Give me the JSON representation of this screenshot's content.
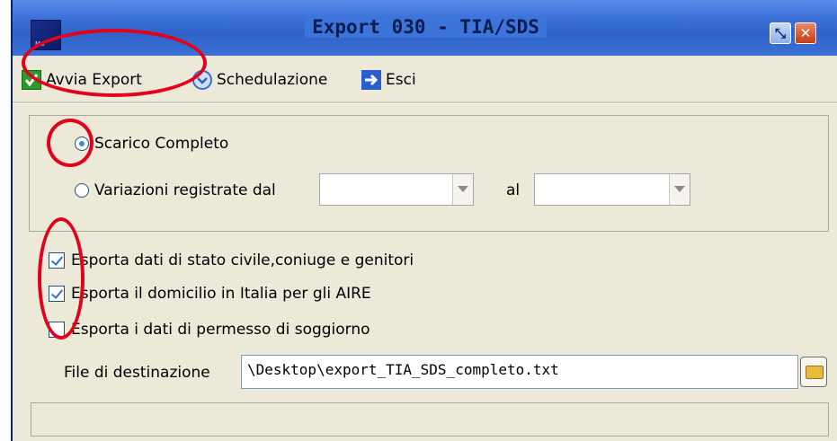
{
  "window": {
    "title": "Export 030 - TIA/SDS",
    "sys_icon_caption": "Ma",
    "restore_glyph": "⤡",
    "close_glyph": "✕"
  },
  "toolbar": {
    "avvia_label": "Avvia Export",
    "schedulazione_label": "Schedulazione",
    "esci_label": "Esci"
  },
  "export_mode": {
    "option_completo": "Scarico Completo",
    "option_variazioni": "Variazioni registrate dal",
    "al_label": "al",
    "selected": "Scarico Completo",
    "from_value": "",
    "to_value": ""
  },
  "options": [
    {
      "label": "Esporta dati di stato civile,coniuge e genitori",
      "checked": true
    },
    {
      "label": "Esporta il domicilio in Italia per gli AIRE",
      "checked": true
    },
    {
      "label": "Esporta i dati di permesso di soggiorno",
      "checked": false
    }
  ],
  "destination": {
    "label": "File di destinazione",
    "value": "\\Desktop\\export_TIA_SDS_completo.txt"
  },
  "colors": {
    "annotation": "#e3001a",
    "titlebar": "#3d74d9",
    "background": "#ece9d8"
  }
}
